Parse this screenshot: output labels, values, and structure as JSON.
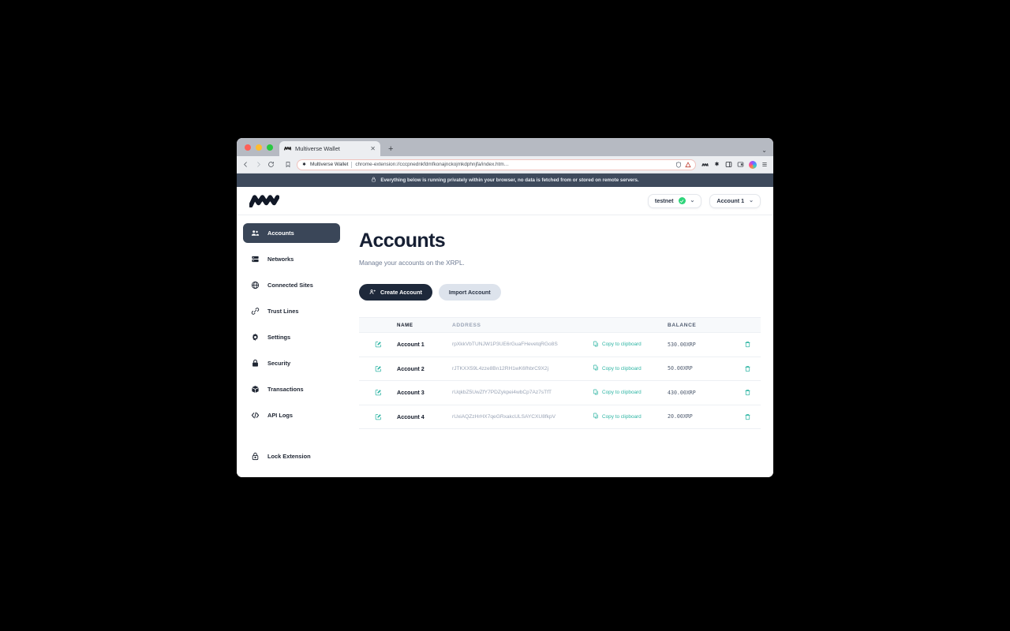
{
  "browser": {
    "tab": {
      "title": "Multiverse Wallet",
      "favicon_icon": "wallet-logo-icon",
      "close_icon": "close-icon"
    },
    "new_tab_label": "+",
    "tabstrip_menu_icon": "chevron-down-icon",
    "toolbar": {
      "back_icon": "back-arrow-icon",
      "forward_icon": "forward-arrow-icon",
      "reload_icon": "reload-icon",
      "bookmark_icon": "bookmark-icon",
      "omnibox": {
        "extension_badge_icon": "extension-puzzle-icon",
        "extension_name": "Multiverse Wallet",
        "url": "chrome-extension://cccpnednkfdmfkonajnckojmkdphnjfa/index.htm…",
        "shield_icon": "shield-icon",
        "warning_icon": "warning-triangle-icon"
      },
      "right_icons": [
        "wallet-extension-icon",
        "extensions-puzzle-icon",
        "side-panel-icon",
        "screenshot-extension-icon",
        "profile-avatar-icon",
        "browser-menu-icon"
      ]
    }
  },
  "privacy_banner": {
    "lock_icon": "lock-icon",
    "text": "Everything below is running privately within your browser, no data is fetched from or stored on remote servers."
  },
  "app": {
    "logo_icon": "multiverse-wallet-logo-icon",
    "network_selector": {
      "label": "testnet",
      "status_icon": "check-circle-icon",
      "chevron_icon": "chevron-down-icon"
    },
    "account_selector": {
      "label": "Account 1",
      "chevron_icon": "chevron-down-icon"
    },
    "sidebar": {
      "items": [
        {
          "label": "Accounts",
          "icon": "users-icon",
          "active": true
        },
        {
          "label": "Networks",
          "icon": "server-icon",
          "active": false
        },
        {
          "label": "Connected Sites",
          "icon": "globe-icon",
          "active": false
        },
        {
          "label": "Trust Lines",
          "icon": "link-icon",
          "active": false
        },
        {
          "label": "Settings",
          "icon": "gear-icon",
          "active": false
        },
        {
          "label": "Security",
          "icon": "lock-closed-icon",
          "active": false
        },
        {
          "label": "Transactions",
          "icon": "cube-icon",
          "active": false
        },
        {
          "label": "API Logs",
          "icon": "code-brackets-icon",
          "active": false
        }
      ],
      "bottom_item": {
        "label": "Lock Extension",
        "icon": "padlock-outline-icon"
      }
    },
    "page": {
      "title": "Accounts",
      "subtitle": "Manage your accounts on the XRPL.",
      "create_button": {
        "label": "Create Account",
        "icon": "user-plus-icon"
      },
      "import_button": {
        "label": "Import Account"
      }
    },
    "table": {
      "columns": [
        "NAME",
        "ADDRESS",
        "BALANCE"
      ],
      "row_actions": {
        "edit_icon": "edit-pencil-square-icon",
        "delete_icon": "trash-icon",
        "copy_icon": "clipboard-copy-icon",
        "copy_label": "Copy to clipboard"
      },
      "rows": [
        {
          "name": "Account 1",
          "address": "rpXkkVbTUNJW1P3UE6rGuaFHevetqRGo8S",
          "balance": "530.00XRP"
        },
        {
          "name": "Account 2",
          "address": "rJTKXX59L4zze8Bn12RH1wK6fhbrC9X2j",
          "balance": "50.00XRP"
        },
        {
          "name": "Account 3",
          "address": "rUqkbZ5UwZfY7PDZykpei4wbCp7Az7sTfT",
          "balance": "430.00XRP"
        },
        {
          "name": "Account 4",
          "address": "rUxiAQZzHrHX7qeGRxakcULSAYCXU8fkpV",
          "balance": "20.00XRP"
        }
      ]
    }
  },
  "colors": {
    "accent_teal": "#2fb5a4",
    "sidebar_active": "#3a4658",
    "primary_dark": "#1e293b",
    "banner_bg": "#3e4a5c",
    "status_green": "#2ed47a"
  }
}
